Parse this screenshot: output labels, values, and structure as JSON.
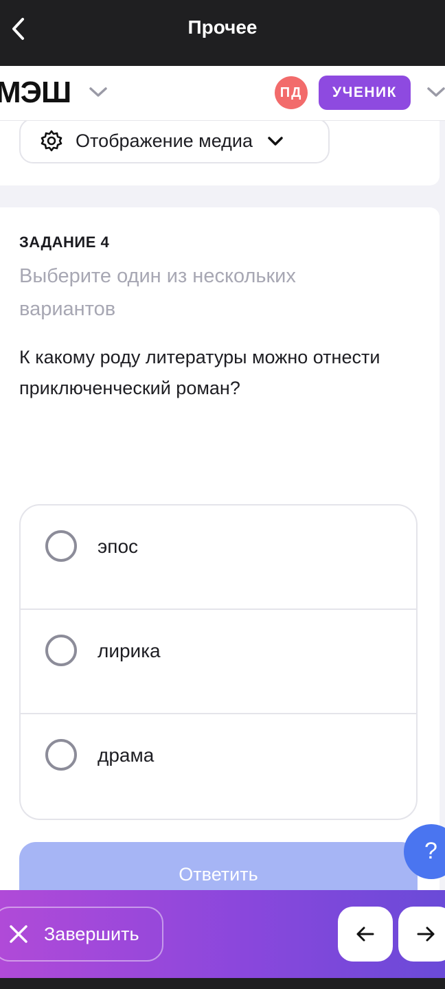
{
  "window": {
    "title": "Прочее"
  },
  "header": {
    "logo": "МЭШ",
    "avatar_initials": "ПД",
    "role": "УЧЕНИК"
  },
  "media_menu": {
    "label": "Отображение медиа"
  },
  "task": {
    "number": "ЗАДАНИЕ 4",
    "instruction": "Выберите один из нескольких вариантов",
    "question": "К какому роду литературы можно отнести приключенческий роман?",
    "options": [
      "эпос",
      "лирика",
      "драма"
    ],
    "submit_label": "Ответить"
  },
  "help": {
    "label": "?"
  },
  "bottom_bar": {
    "finish_label": "Завершить"
  },
  "colors": {
    "accent_purple": "#8e4ae0",
    "avatar_red": "#f26b6b",
    "submit_disabled": "#a6b5f5",
    "help_blue": "#4a75f0"
  },
  "icons": [
    "back-icon",
    "chevron-down-icon",
    "gear-icon",
    "close-icon",
    "arrow-left-icon",
    "arrow-right-icon"
  ]
}
